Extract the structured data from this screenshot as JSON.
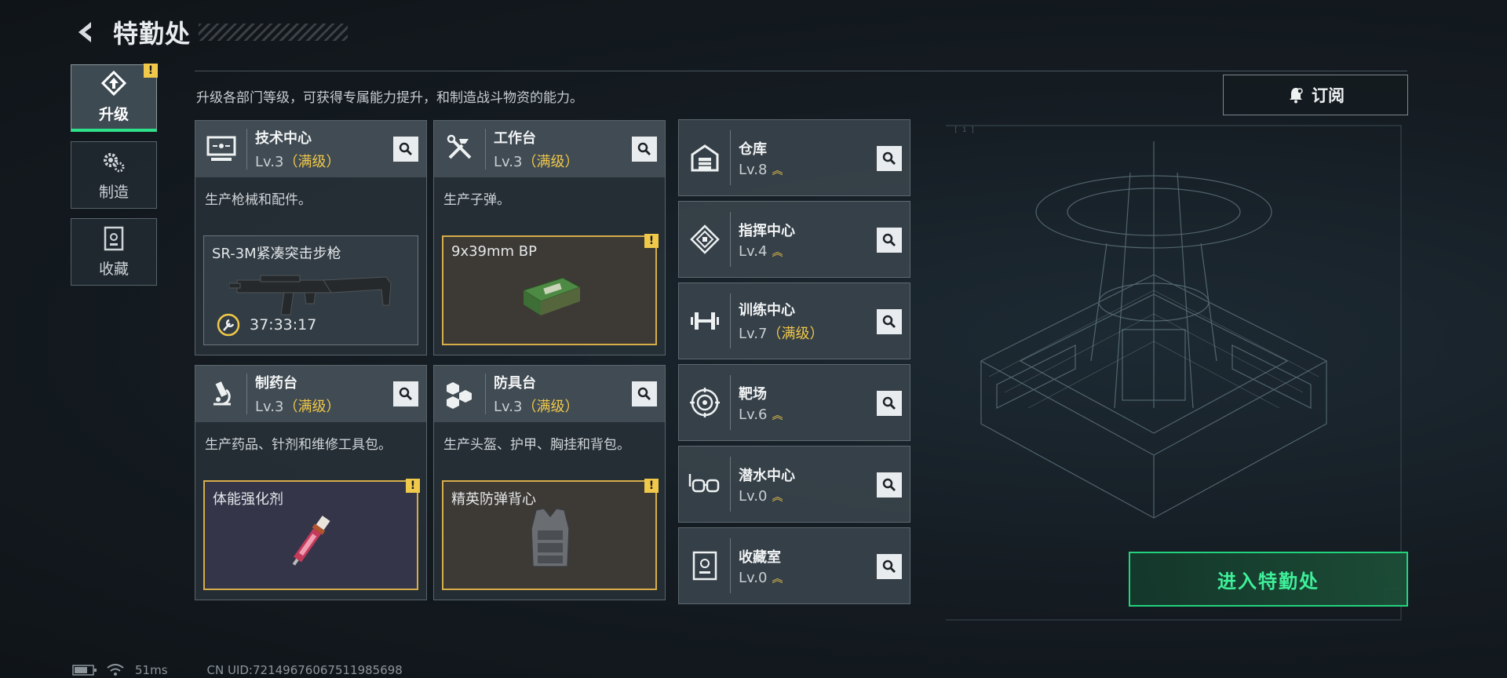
{
  "header": {
    "title": "特勤处"
  },
  "sidenav": [
    {
      "label": "升级",
      "icon": "upgrade-icon",
      "active": true,
      "badge": "!"
    },
    {
      "label": "制造",
      "icon": "gears-icon",
      "active": false
    },
    {
      "label": "收藏",
      "icon": "collection-icon",
      "active": false
    }
  ],
  "subtitle": "升级各部门等级，可获得专属能力提升，和制造战斗物资的能力。",
  "subscribe_label": "订阅",
  "cards": [
    {
      "name": "技术中心",
      "level": "Lv.3",
      "max": "（满级）",
      "icon": "computer-icon",
      "desc": "生产枪械和配件。",
      "product": "SR-3M紧凑突击步枪",
      "product_icon": "rifle-icon",
      "timer": "37:33:17",
      "highlight": false
    },
    {
      "name": "工作台",
      "level": "Lv.3",
      "max": "（满级）",
      "icon": "tools-icon",
      "desc": "生产子弹。",
      "product": "9x39mm BP",
      "product_icon": "ammo-box-icon",
      "highlight": true,
      "badge": "!"
    },
    {
      "name": "制药台",
      "level": "Lv.3",
      "max": "（满级）",
      "icon": "microscope-icon",
      "desc": "生产药品、针剂和维修工具包。",
      "product": "体能强化剂",
      "product_icon": "syringe-icon",
      "highlight": true,
      "badge": "!"
    },
    {
      "name": "防具台",
      "level": "Lv.3",
      "max": "（满级）",
      "icon": "armor-blocks-icon",
      "desc": "生产头盔、护甲、胸挂和背包。",
      "product": "精英防弹背心",
      "product_icon": "vest-icon",
      "highlight": true,
      "badge": "!"
    }
  ],
  "buildings": [
    {
      "name": "仓库",
      "level": "Lv.8",
      "max": "",
      "icon": "warehouse-icon"
    },
    {
      "name": "指挥中心",
      "level": "Lv.4",
      "max": "",
      "icon": "command-icon"
    },
    {
      "name": "训练中心",
      "level": "Lv.7",
      "max": "（满级）",
      "icon": "dumbbell-icon"
    },
    {
      "name": "靶场",
      "level": "Lv.6",
      "max": "",
      "icon": "target-icon"
    },
    {
      "name": "潜水中心",
      "level": "Lv.0",
      "max": "",
      "icon": "diving-mask-icon"
    },
    {
      "name": "收藏室",
      "level": "Lv.0",
      "max": "",
      "icon": "collection-room-icon"
    }
  ],
  "enter_label": "进入特勤处",
  "status": {
    "ping": "51ms",
    "uid": "CN UID:72149676067511985698"
  },
  "colors": {
    "accent": "#2ee08a",
    "gold": "#f0c84a",
    "panel": "#3a444c"
  }
}
